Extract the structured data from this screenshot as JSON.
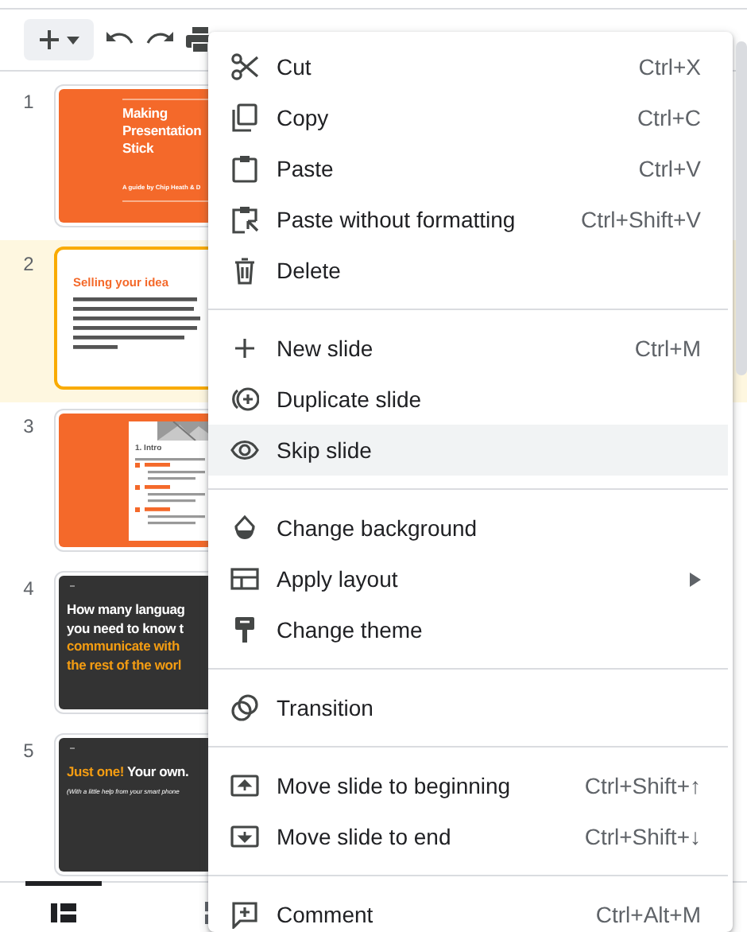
{
  "slides": [
    {
      "number": "1",
      "selected": false,
      "kind": "cover",
      "title_lines": [
        "Making",
        "Presentation",
        "Stick"
      ],
      "subtitle": "A guide by Chip Heath & D"
    },
    {
      "number": "2",
      "selected": true,
      "kind": "text",
      "heading": "Selling your idea"
    },
    {
      "number": "3",
      "selected": false,
      "kind": "card",
      "heading": "1. Intro"
    },
    {
      "number": "4",
      "selected": false,
      "kind": "dark",
      "lines": [
        [
          {
            "text": "How many languag",
            "accent": false
          }
        ],
        [
          {
            "text": "you need to know t",
            "accent": false
          }
        ],
        [
          {
            "text": "communicate with",
            "accent": true
          }
        ],
        [
          {
            "text": "the rest of the worl",
            "accent": true
          }
        ]
      ]
    },
    {
      "number": "5",
      "selected": false,
      "kind": "dark",
      "lines": [
        [
          {
            "text": "Just one!",
            "accent": true
          },
          {
            "text": "Your own.",
            "accent": false
          }
        ]
      ],
      "note": "(With a little help from your smart phone"
    }
  ],
  "view_tabs": [
    {
      "selected": true
    },
    {
      "selected": false
    }
  ],
  "menu": {
    "groups": [
      {
        "items": [
          {
            "label": "Cut",
            "shortcut": "Ctrl+X",
            "highlighted": false,
            "submenu": false
          },
          {
            "label": "Copy",
            "shortcut": "Ctrl+C",
            "highlighted": false,
            "submenu": false
          },
          {
            "label": "Paste",
            "shortcut": "Ctrl+V",
            "highlighted": false,
            "submenu": false
          },
          {
            "label": "Paste without formatting",
            "shortcut": "Ctrl+Shift+V",
            "highlighted": false,
            "submenu": false
          },
          {
            "label": "Delete",
            "highlighted": false,
            "submenu": false
          }
        ]
      },
      {
        "items": [
          {
            "label": "New slide",
            "shortcut": "Ctrl+M",
            "highlighted": false,
            "submenu": false
          },
          {
            "label": "Duplicate slide",
            "highlighted": false,
            "submenu": false
          },
          {
            "label": "Skip slide",
            "highlighted": true,
            "submenu": false
          }
        ]
      },
      {
        "items": [
          {
            "label": "Change background",
            "highlighted": false,
            "submenu": false
          },
          {
            "label": "Apply layout",
            "highlighted": false,
            "submenu": true
          },
          {
            "label": "Change theme",
            "highlighted": false,
            "submenu": false
          }
        ]
      },
      {
        "items": [
          {
            "label": "Transition",
            "highlighted": false,
            "submenu": false
          }
        ]
      },
      {
        "items": [
          {
            "label": "Move slide to beginning",
            "shortcut": "Ctrl+Shift+↑",
            "highlighted": false,
            "submenu": false
          },
          {
            "label": "Move slide to end",
            "shortcut": "Ctrl+Shift+↓",
            "highlighted": false,
            "submenu": false
          }
        ]
      },
      {
        "items": [
          {
            "label": "Comment",
            "shortcut": "Ctrl+Alt+M",
            "highlighted": false,
            "submenu": false
          }
        ]
      }
    ]
  }
}
